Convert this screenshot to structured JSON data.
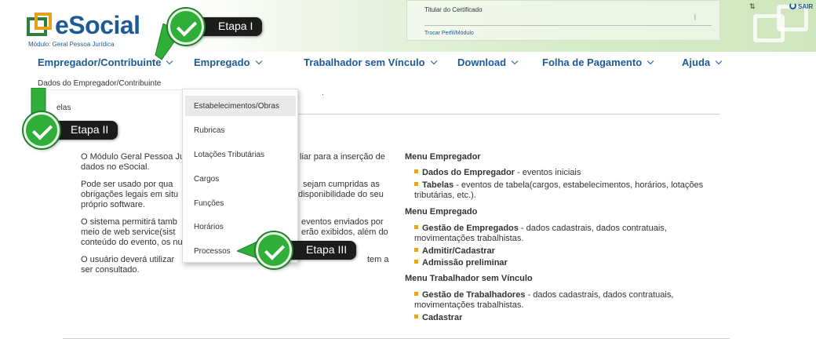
{
  "app": {
    "logo_text": "eSocial",
    "logo_subtitle": "Módulo: Geral Pessoa Jurídica"
  },
  "header": {
    "certificate_label": "Titular do Certificado",
    "certificate_tick": "|",
    "change_profile_link": "Trocar Perfil/Módulo",
    "exit_label": "SAIR"
  },
  "nav": {
    "items": [
      {
        "label": "Empregador/Contribuinte"
      },
      {
        "label": "Empregado"
      },
      {
        "label": "Trabalhador sem Vínculo"
      },
      {
        "label": "Download"
      },
      {
        "label": "Folha de Pagamento"
      },
      {
        "label": "Ajuda"
      }
    ]
  },
  "employer_submenu": {
    "items": [
      {
        "label": "Dados do Empregador/Contribuinte"
      },
      {
        "label": "Tabelas"
      }
    ],
    "tables_visible_fragment": "elas"
  },
  "tables_dropdown": {
    "items": [
      {
        "label": "Estabelecimentos/Obras",
        "active": true
      },
      {
        "label": "Rubricas"
      },
      {
        "label": "Lotações Tributárias"
      },
      {
        "label": "Cargos"
      },
      {
        "label": "Funções"
      },
      {
        "label": "Horários"
      },
      {
        "label": "Processos"
      }
    ]
  },
  "left_text": {
    "p1_left": [
      "O Módulo Geral Pessoa Ju",
      "dados no eSocial."
    ],
    "p1_right": "liar para a inserção de",
    "p2_left": [
      "Pode ser usado por qua",
      "obrigações legais em situ",
      "próprio software."
    ],
    "p2_right": [
      "sejam cumpridas as",
      "disponibilidade do seu"
    ],
    "p3_left": [
      "O sistema permitirá tamb",
      "meio de web service(sist",
      "conteúdo do evento, os nu"
    ],
    "p3_right": [
      "eventos enviados por",
      "erão exibidos, além do"
    ],
    "p4_left": [
      "O usuário deverá utilizar",
      "ser consultado."
    ],
    "p4_right": "tem a"
  },
  "right_column": {
    "sections": [
      {
        "title": "Menu Empregador",
        "items": [
          {
            "bold": "Dados do Empregador",
            "rest": " - eventos iniciais"
          },
          {
            "bold": "Tabelas",
            "rest": " - eventos de tabela(cargos, estabelecimentos, horários, lotações tributárias, etc.)."
          }
        ]
      },
      {
        "title": "Menu Empregado",
        "items": [
          {
            "bold": "Gestão de Empregados",
            "rest": " - dados cadastrais, dados contratuais, movimentações trabalhistas."
          },
          {
            "bold": "Admitir/Cadastrar",
            "rest": ""
          },
          {
            "bold": "Admissão preliminar",
            "rest": ""
          }
        ]
      },
      {
        "title": "Menu Trabalhador sem Vínculo",
        "items": [
          {
            "bold": "Gestão de Trabalhadores",
            "rest": " - dados cadastrais, dados contratuais, movimentações trabalhistas."
          },
          {
            "bold": "Cadastrar",
            "rest": ""
          }
        ]
      }
    ]
  },
  "steps": [
    {
      "label": "Etapa I"
    },
    {
      "label": "Etapa II"
    },
    {
      "label": "Etapa III"
    }
  ],
  "colors": {
    "brand_blue": "#1d5a96",
    "brand_green": "#2d7f3e",
    "bullet_orange": "#e8a317",
    "check_green": "#2fae3a"
  }
}
